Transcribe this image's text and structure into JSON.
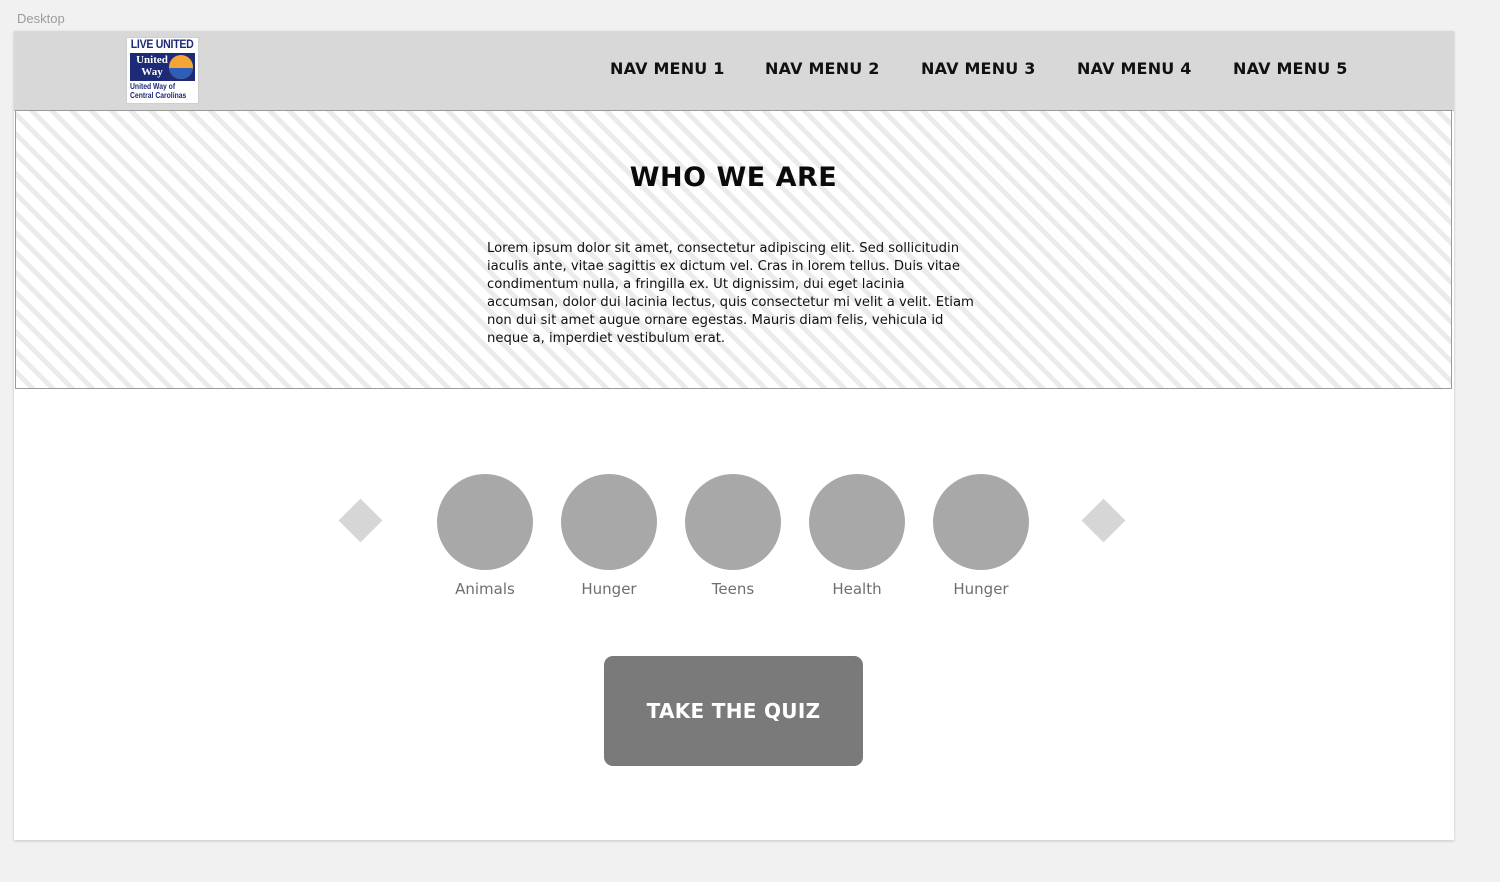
{
  "artboard_label": "Desktop",
  "logo": {
    "top_text": "LIVE UNITED",
    "mid_text": "United Way",
    "bottom_text": "United Way of Central Carolinas"
  },
  "nav": {
    "items": [
      "NAV MENU 1",
      "NAV MENU 2",
      "NAV MENU 3",
      "NAV MENU 4",
      "NAV MENU 5"
    ]
  },
  "hero": {
    "title": "WHO WE ARE",
    "body": "Lorem ipsum dolor sit amet, consectetur adipiscing elit. Sed sollicitudin iaculis ante, vitae sagittis ex dictum vel. Cras in lorem tellus. Duis vitae condimentum nulla, a fringilla ex. Ut dignissim, dui eget lacinia accumsan, dolor dui lacinia lectus, quis consectetur mi velit a velit. Etiam non dui sit amet augue ornare egestas. Mauris diam felis, vehicula id neque a, imperdiet vestibulum erat."
  },
  "carousel": {
    "prev_icon": "diamond-arrow-left-icon",
    "next_icon": "diamond-arrow-right-icon",
    "categories": [
      "Animals",
      "Hunger",
      "Teens",
      "Health",
      "Hunger"
    ]
  },
  "cta": {
    "label": "TAKE THE QUIZ"
  },
  "colors": {
    "header_bg": "#d8d8d8",
    "circle": "#a8a8a8",
    "button": "#7a7a7a",
    "logo_blue": "#1c2a77"
  }
}
